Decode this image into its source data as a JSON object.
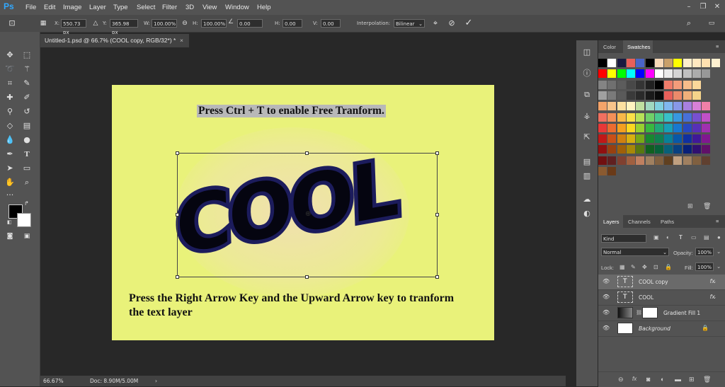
{
  "menubar": {
    "logo": "Ps",
    "items": [
      "File",
      "Edit",
      "Image",
      "Layer",
      "Type",
      "Select",
      "Filter",
      "3D",
      "View",
      "Window",
      "Help"
    ]
  },
  "options": {
    "x_label": "X:",
    "x_value": "550.73 px",
    "y_label": "Y:",
    "y_value": "365.98 px",
    "w_label": "W:",
    "w_value": "100.00%",
    "h_label": "H:",
    "h_value": "100.00%",
    "angle_value": "0.00",
    "hskew_label": "H:",
    "hskew_value": "0.00",
    "vskew_label": "V:",
    "vskew_value": "0.00",
    "interp_label": "Interpolation:",
    "interp_value": "Bilinear"
  },
  "document_tab": {
    "title": "Untitled-1.psd @ 66.7% (COOL copy, RGB/32*) *",
    "close": "×"
  },
  "canvas": {
    "heading": "Press Ctrl + T to enable Free Tranform.",
    "art_text": "COOL",
    "instruction": "Press the Right Arrow Key and the Upward Arrow key to tranform the text layer"
  },
  "status": {
    "zoom": "66.67%",
    "doc": "Doc: 8.90M/5.00M"
  },
  "color_panel": {
    "tabs": [
      "Color",
      "Swatches"
    ],
    "active_tab": "Swatches"
  },
  "swatches": [
    [
      "#000000",
      "#ffffff",
      "#1a1a40",
      "#e8605a",
      "#4a64c8",
      "#000000",
      "#f8d9b8",
      "#c9a06a",
      "#ffff00",
      "#ffeecc",
      "#ffe8c0",
      "#ffe0b0",
      "#fff0d0"
    ],
    [
      "#ff0000",
      "#ffff00",
      "#00ff00",
      "#00ffff",
      "#0000ff",
      "#ff00ff",
      "#ffffff",
      "#eaeaea",
      "#d4d4d4",
      "#c0c0c0",
      "#acacac",
      "#989898",
      ""
    ],
    [
      "#848484",
      "#707070",
      "#5c5c5c",
      "#484848",
      "#343434",
      "#202020",
      "#000000",
      "#f07c6a",
      "#f49c7a",
      "#f8bc8a",
      "#fcd89a",
      ""
    ],
    [
      "#a0a0a0",
      "#7a7a7a",
      "#5a5a5a",
      "#3a3a3a",
      "#2a2a2a",
      "#1a1a1a",
      "#0a0a0a",
      "#e8605a",
      "#ec8a6a",
      "#f0b07a",
      "#f4d48a",
      ""
    ],
    [
      "#f4a46a",
      "#f8c48a",
      "#fce0a0",
      "#fff4c0",
      "#c0e0a0",
      "#a0d8c0",
      "#80d0e0",
      "#80b8f0",
      "#8898e8",
      "#a880e0",
      "#d880d8",
      "#f080a8",
      ""
    ],
    [
      "#f07060",
      "#f49058",
      "#f8b848",
      "#fce048",
      "#b8e058",
      "#70d068",
      "#48c890",
      "#38c0c8",
      "#3898e0",
      "#4870d8",
      "#7850d0",
      "#c050c8",
      ""
    ],
    [
      "#e83838",
      "#ec6c30",
      "#f4a020",
      "#fcd820",
      "#98d030",
      "#38b840",
      "#20a878",
      "#18a0b8",
      "#1878d0",
      "#2848c0",
      "#5830b8",
      "#a030b0",
      ""
    ],
    [
      "#c01818",
      "#c85018",
      "#d08010",
      "#d8b010",
      "#78a818",
      "#188830",
      "#108050",
      "#088098",
      "#0858a8",
      "#1030a0",
      "#401898",
      "#801890",
      ""
    ],
    [
      "#901010",
      "#984010",
      "#a06008",
      "#a88808",
      "#587810",
      "#106020",
      "#086038",
      "#086078",
      "#084080",
      "#082078",
      "#301070",
      "#601068",
      ""
    ],
    [
      "#701010",
      "#602020",
      "#804030",
      "#a06040",
      "#c08060",
      "#a08060",
      "#806040",
      "#604020",
      "#c0a080",
      "#a08060",
      "#806040",
      "#604030",
      ""
    ],
    [
      "#8a5a30",
      "#6a3a18"
    ]
  ],
  "layers_panel": {
    "tabs": [
      "Layers",
      "Channels",
      "Paths"
    ],
    "active_tab": "Layers",
    "kind_label": "Kind",
    "blend_mode": "Normal",
    "opacity_label": "Opacity:",
    "opacity_value": "100%",
    "lock_label": "Lock:",
    "fill_label": "Fill:",
    "fill_value": "100%",
    "layers": [
      {
        "name": "COOL copy",
        "fx": "fx",
        "selected": true
      },
      {
        "name": "COOL",
        "fx": "fx",
        "selected": false
      },
      {
        "name": "Gradient Fill 1",
        "fx": "",
        "selected": false
      },
      {
        "name": "Background",
        "fx": "",
        "selected": false
      }
    ]
  },
  "colors": {
    "canvas_bg": "#e9f27a",
    "text_fill": "#050510",
    "text_stroke": "#1c1c5c",
    "ui_panel": "#535353",
    "accent_blue": "#31a8ff"
  }
}
